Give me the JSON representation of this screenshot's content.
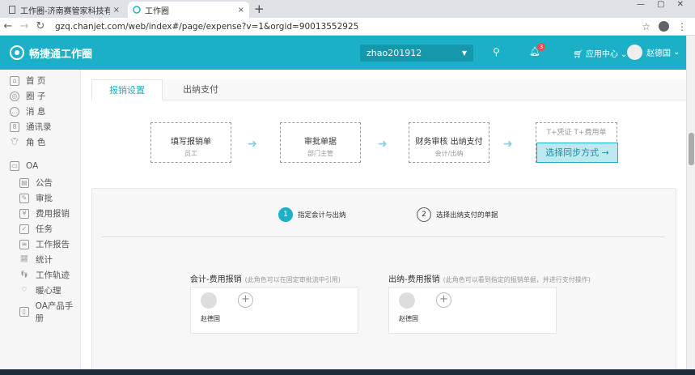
{
  "browser": {
    "tabs": [
      {
        "title": "工作圈-济南赛管家科技有限公司",
        "close": "×"
      },
      {
        "title": "工作圈",
        "close": "×"
      }
    ],
    "new_tab": "+",
    "url": "gzq.chanjet.com/web/index#/page/expense?v=1&orgid=90013552925"
  },
  "header": {
    "logo": "畅捷通工作圈",
    "org": "zhao201912",
    "notification_count": "3",
    "app_center": "应用中心",
    "user": "赵德国"
  },
  "sidebar": {
    "items": [
      {
        "label": "首 页",
        "icon": "home-icon"
      },
      {
        "label": "圈 子",
        "icon": "circle-icon"
      },
      {
        "label": "消 息",
        "icon": "message-icon"
      },
      {
        "label": "通讯录",
        "icon": "contacts-icon"
      },
      {
        "label": "角 色",
        "icon": "shirt-icon"
      }
    ],
    "oa": {
      "label": "OA",
      "icon": "monitor-icon"
    },
    "oa_items": [
      {
        "label": "公告",
        "icon": "announce-icon"
      },
      {
        "label": "审批",
        "icon": "approve-icon"
      },
      {
        "label": "费用报销",
        "icon": "expense-icon"
      },
      {
        "label": "任务",
        "icon": "task-icon"
      },
      {
        "label": "工作报告",
        "icon": "report-icon"
      },
      {
        "label": "统计",
        "icon": "stats-icon"
      },
      {
        "label": "工作轨迹",
        "icon": "track-icon"
      },
      {
        "label": "暖心理",
        "icon": "heart-icon"
      },
      {
        "label": "OA产品手册",
        "icon": "manual-icon"
      }
    ]
  },
  "main": {
    "tabs": [
      {
        "label": "报销设置"
      },
      {
        "label": "出纳支付"
      }
    ],
    "flow": [
      {
        "title": "填写报销单",
        "sub": "员工"
      },
      {
        "title": "审批单据",
        "sub": "部门主管"
      },
      {
        "title": "财务审核  出纳支付",
        "sub": "会计/出纳"
      }
    ],
    "sync_options": "T+凭证   T+费用单",
    "sync_button": "选择同步方式 →",
    "steps": [
      {
        "num": "1",
        "label": "指定会计与出纳"
      },
      {
        "num": "2",
        "label": "选择出纳支付的单据"
      }
    ],
    "roles": [
      {
        "title": "会计-费用报销",
        "hint": "(此角色可以在固定审批流中引用)",
        "member": "赵德国"
      },
      {
        "title": "出纳-费用报销",
        "hint": "(此角色可以看到指定的报销单据，并进行支付操作)",
        "member": "赵德国"
      }
    ]
  }
}
